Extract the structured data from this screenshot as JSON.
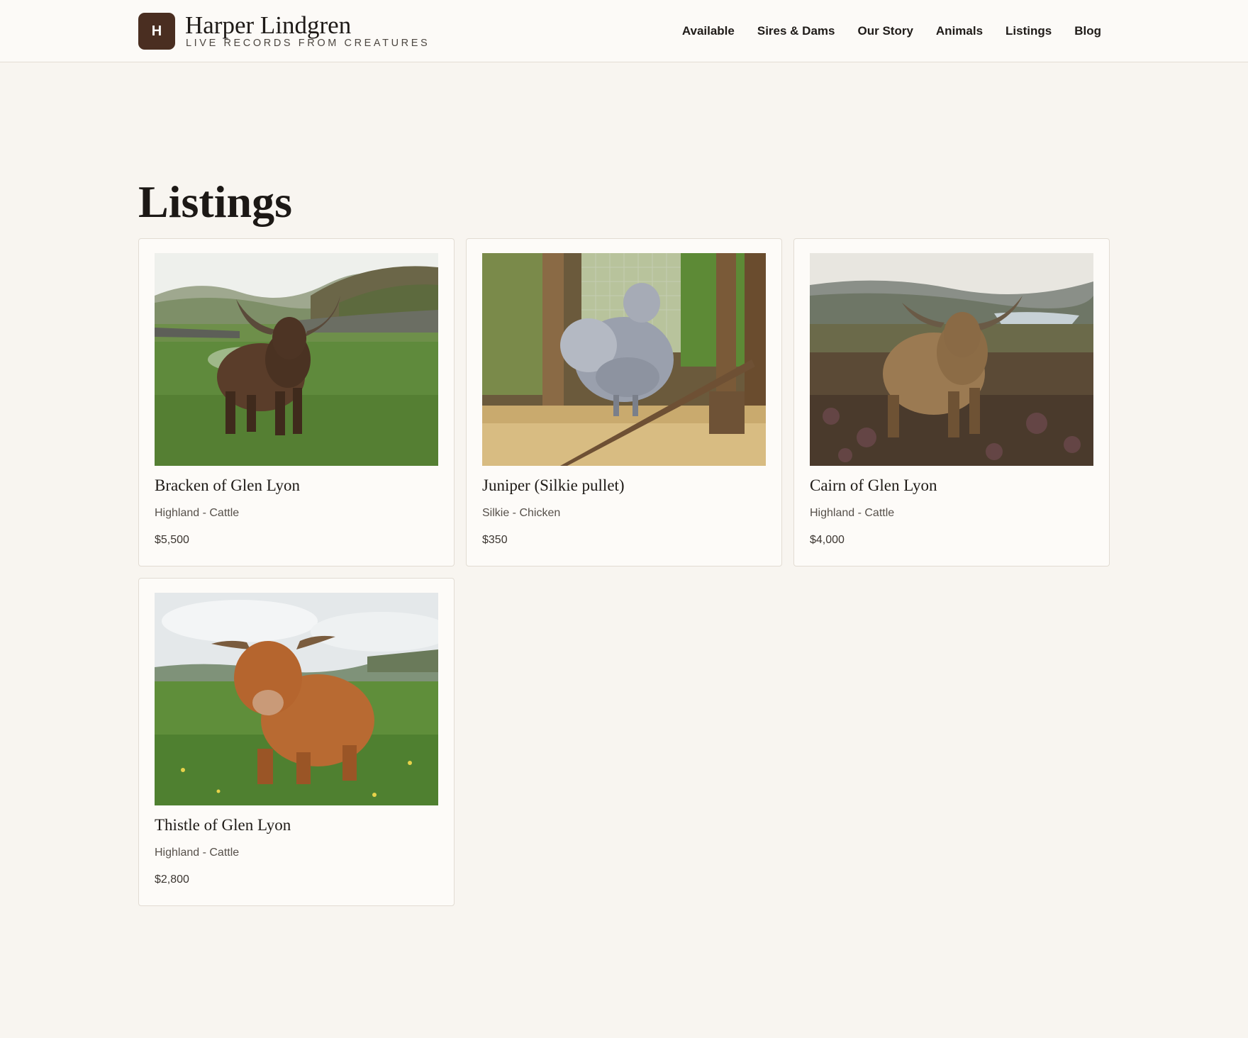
{
  "brand": {
    "logo_letter": "H",
    "name": "Harper Lindgren",
    "tagline": "LIVE RECORDS FROM CREATURES",
    "logo_color": "#4a2e21"
  },
  "nav": {
    "items": [
      {
        "label": "Available"
      },
      {
        "label": "Sires & Dams"
      },
      {
        "label": "Our Story"
      },
      {
        "label": "Animals"
      },
      {
        "label": "Listings"
      },
      {
        "label": "Blog"
      }
    ]
  },
  "page": {
    "title": "Listings"
  },
  "listings": [
    {
      "name": "Bracken of Glen Lyon",
      "breed": "Highland - Cattle",
      "price": "$5,500",
      "photo": "highland-cow-dark-photo"
    },
    {
      "name": "Juniper (Silkie pullet)",
      "breed": "Silkie - Chicken",
      "price": "$350",
      "photo": "silkie-chicken-photo"
    },
    {
      "name": "Cairn of Glen Lyon",
      "breed": "Highland - Cattle",
      "price": "$4,000",
      "photo": "highland-cow-heather-photo"
    },
    {
      "name": "Thistle of Glen Lyon",
      "breed": "Highland - Cattle",
      "price": "$2,800",
      "photo": "highland-calf-ginger-photo"
    }
  ],
  "colors": {
    "page_background": "#f8f5f0",
    "card_background": "#fdfbf8",
    "card_border": "#e2dcd3"
  }
}
